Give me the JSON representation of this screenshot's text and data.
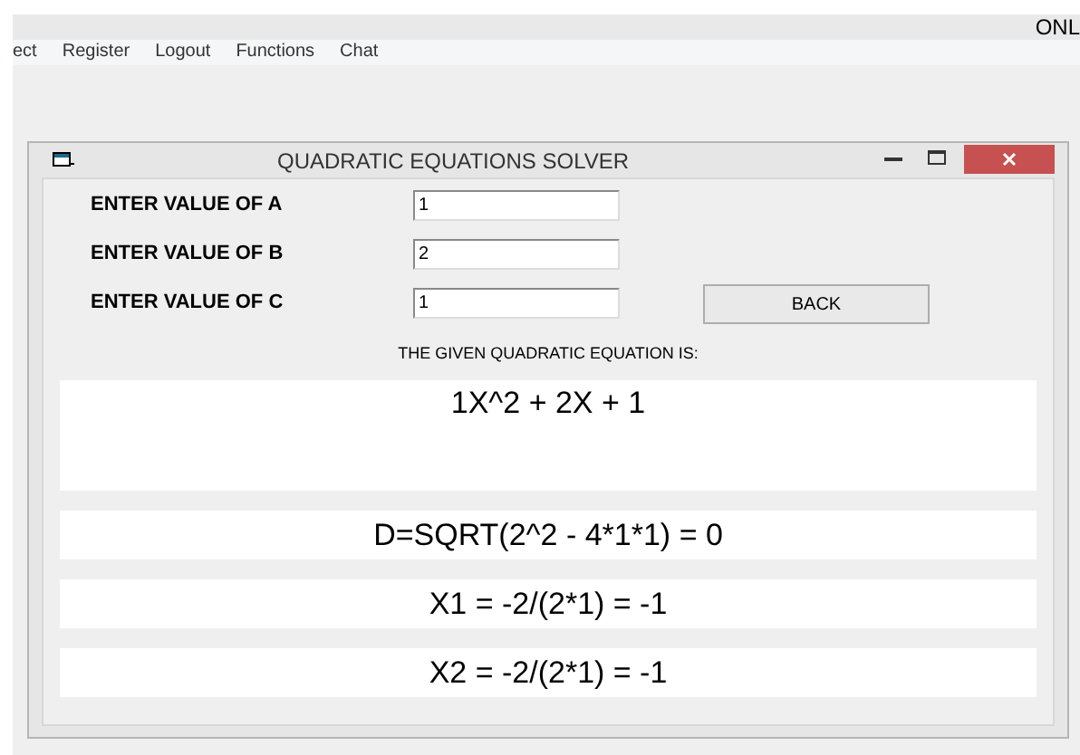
{
  "app_title": "ONL",
  "menu": [
    "ect",
    "Register",
    "Logout",
    "Functions",
    "Chat"
  ],
  "dialog": {
    "title": "QUADRATIC EQUATIONS SOLVER",
    "fields": [
      {
        "label": "ENTER VALUE OF A",
        "value": "1"
      },
      {
        "label": "ENTER VALUE OF B",
        "value": "2"
      },
      {
        "label": "ENTER VALUE OF C",
        "value": "1"
      }
    ],
    "back_button": "BACK",
    "equation_caption": "THE GIVEN QUADRATIC EQUATION IS:",
    "equation": "1X^2 + 2X + 1",
    "results": [
      "D=SQRT(2^2 - 4*1*1) = 0",
      "X1 = -2/(2*1) = -1",
      "X2 = -2/(2*1) = -1"
    ]
  }
}
